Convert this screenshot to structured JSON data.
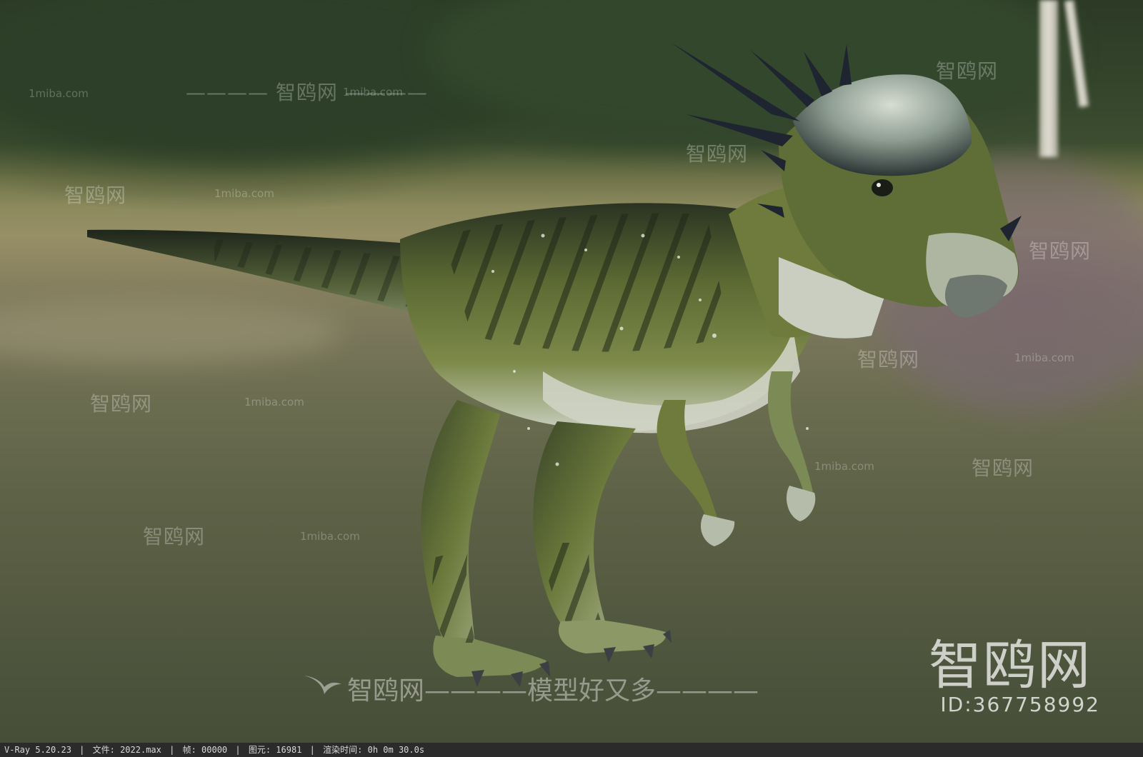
{
  "render": {
    "background_colors": {
      "forest": "#34452c",
      "meadow": "#8c8a5e",
      "ground": "#5f6348"
    },
    "subject_colors": {
      "skin_green": "#6f7b3c",
      "skin_dark": "#2a3322",
      "belly": "#cfd3c4",
      "spikes": "#1f2530"
    }
  },
  "watermarks": {
    "brand": "智鸥网",
    "url": "1miba.com",
    "separator": "————",
    "slogan": "智鸥网————模型好又多————",
    "big_logo": "智鸥网",
    "id_label": "ID:367758992"
  },
  "statusbar": {
    "renderer": "V-Ray 5.20.23",
    "file": "文件: 2022.max",
    "frame": "帧: 00000",
    "primitives": "图元: 16981",
    "render_time": "渲染时间:  0h  0m 30.0s",
    "divider": "|"
  }
}
